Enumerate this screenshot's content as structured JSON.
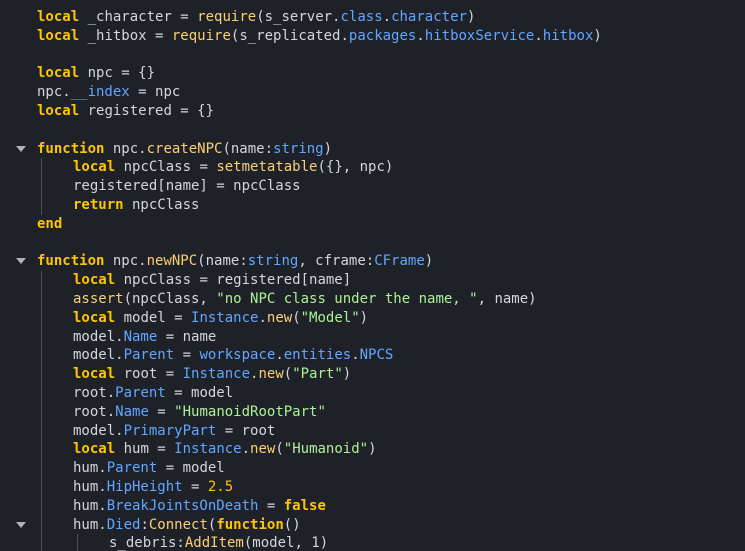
{
  "editor": {
    "language": "lua",
    "theme_colors": {
      "background": "#1e2228",
      "keyword": "#ffc600",
      "function": "#fad075",
      "property": "#61a6ff",
      "string": "#adf195",
      "plain": "#d3d6dc"
    },
    "lines": [
      {
        "fold": false,
        "indent": 0,
        "tokens": [
          {
            "t": "local",
            "c": "kw"
          },
          {
            "t": " _character = ",
            "c": "pl"
          },
          {
            "t": "require",
            "c": "fn"
          },
          {
            "t": "(s_server.",
            "c": "pl"
          },
          {
            "t": "class",
            "c": "pr"
          },
          {
            "t": ".",
            "c": "pl"
          },
          {
            "t": "character",
            "c": "pr"
          },
          {
            "t": ")",
            "c": "pl"
          }
        ]
      },
      {
        "fold": false,
        "indent": 0,
        "tokens": [
          {
            "t": "local",
            "c": "kw"
          },
          {
            "t": " _hitbox = ",
            "c": "pl"
          },
          {
            "t": "require",
            "c": "fn"
          },
          {
            "t": "(s_replicated.",
            "c": "pl"
          },
          {
            "t": "packages",
            "c": "pr"
          },
          {
            "t": ".",
            "c": "pl"
          },
          {
            "t": "hitboxService",
            "c": "pr"
          },
          {
            "t": ".",
            "c": "pl"
          },
          {
            "t": "hitbox",
            "c": "pr"
          },
          {
            "t": ")",
            "c": "pl"
          }
        ]
      },
      {
        "fold": false,
        "indent": 0,
        "tokens": []
      },
      {
        "fold": false,
        "indent": 0,
        "tokens": [
          {
            "t": "local",
            "c": "kw"
          },
          {
            "t": " npc = {}",
            "c": "pl"
          }
        ]
      },
      {
        "fold": false,
        "indent": 0,
        "tokens": [
          {
            "t": "npc.",
            "c": "pl"
          },
          {
            "t": "__index",
            "c": "pr"
          },
          {
            "t": " = npc",
            "c": "pl"
          }
        ]
      },
      {
        "fold": false,
        "indent": 0,
        "tokens": [
          {
            "t": "local",
            "c": "kw"
          },
          {
            "t": " registered = {}",
            "c": "pl"
          }
        ]
      },
      {
        "fold": false,
        "indent": 0,
        "tokens": []
      },
      {
        "fold": true,
        "indent": 0,
        "tokens": [
          {
            "t": "function",
            "c": "kw"
          },
          {
            "t": " npc.",
            "c": "pl"
          },
          {
            "t": "createNPC",
            "c": "fn"
          },
          {
            "t": "(name:",
            "c": "pl"
          },
          {
            "t": "string",
            "c": "ty"
          },
          {
            "t": ")",
            "c": "pl"
          }
        ]
      },
      {
        "fold": false,
        "indent": 1,
        "tokens": [
          {
            "t": "local",
            "c": "kw"
          },
          {
            "t": " npcClass = ",
            "c": "pl"
          },
          {
            "t": "setmetatable",
            "c": "fn"
          },
          {
            "t": "({}, npc)",
            "c": "pl"
          }
        ]
      },
      {
        "fold": false,
        "indent": 1,
        "tokens": [
          {
            "t": "registered[name] = npcClass",
            "c": "pl"
          }
        ]
      },
      {
        "fold": false,
        "indent": 1,
        "tokens": [
          {
            "t": "return",
            "c": "kw"
          },
          {
            "t": " npcClass",
            "c": "pl"
          }
        ]
      },
      {
        "fold": false,
        "indent": 0,
        "tokens": [
          {
            "t": "end",
            "c": "kw"
          }
        ]
      },
      {
        "fold": false,
        "indent": 0,
        "tokens": []
      },
      {
        "fold": true,
        "indent": 0,
        "tokens": [
          {
            "t": "function",
            "c": "kw"
          },
          {
            "t": " npc.",
            "c": "pl"
          },
          {
            "t": "newNPC",
            "c": "fn"
          },
          {
            "t": "(name:",
            "c": "pl"
          },
          {
            "t": "string",
            "c": "ty"
          },
          {
            "t": ", cframe:",
            "c": "pl"
          },
          {
            "t": "CFrame",
            "c": "ty"
          },
          {
            "t": ")",
            "c": "pl"
          }
        ]
      },
      {
        "fold": false,
        "indent": 1,
        "tokens": [
          {
            "t": "local",
            "c": "kw"
          },
          {
            "t": " npcClass = registered[name]",
            "c": "pl"
          }
        ]
      },
      {
        "fold": false,
        "indent": 1,
        "tokens": [
          {
            "t": "assert",
            "c": "fn"
          },
          {
            "t": "(npcClass, ",
            "c": "pl"
          },
          {
            "t": "\"no NPC class under the name, \"",
            "c": "st"
          },
          {
            "t": ", name)",
            "c": "pl"
          }
        ]
      },
      {
        "fold": false,
        "indent": 1,
        "tokens": [
          {
            "t": "local",
            "c": "kw"
          },
          {
            "t": " model = ",
            "c": "pl"
          },
          {
            "t": "Instance",
            "c": "pr"
          },
          {
            "t": ".",
            "c": "pl"
          },
          {
            "t": "new",
            "c": "fn"
          },
          {
            "t": "(",
            "c": "pl"
          },
          {
            "t": "\"Model\"",
            "c": "st"
          },
          {
            "t": ")",
            "c": "pl"
          }
        ]
      },
      {
        "fold": false,
        "indent": 1,
        "tokens": [
          {
            "t": "model.",
            "c": "pl"
          },
          {
            "t": "Name",
            "c": "pr"
          },
          {
            "t": " = name",
            "c": "pl"
          }
        ]
      },
      {
        "fold": false,
        "indent": 1,
        "tokens": [
          {
            "t": "model.",
            "c": "pl"
          },
          {
            "t": "Parent",
            "c": "pr"
          },
          {
            "t": " = ",
            "c": "pl"
          },
          {
            "t": "workspace",
            "c": "pr"
          },
          {
            "t": ".",
            "c": "pl"
          },
          {
            "t": "entities",
            "c": "pr"
          },
          {
            "t": ".",
            "c": "pl"
          },
          {
            "t": "NPCS",
            "c": "pr"
          }
        ]
      },
      {
        "fold": false,
        "indent": 1,
        "tokens": [
          {
            "t": "local",
            "c": "kw"
          },
          {
            "t": " root = ",
            "c": "pl"
          },
          {
            "t": "Instance",
            "c": "pr"
          },
          {
            "t": ".",
            "c": "pl"
          },
          {
            "t": "new",
            "c": "fn"
          },
          {
            "t": "(",
            "c": "pl"
          },
          {
            "t": "\"Part\"",
            "c": "st"
          },
          {
            "t": ")",
            "c": "pl"
          }
        ]
      },
      {
        "fold": false,
        "indent": 1,
        "tokens": [
          {
            "t": "root.",
            "c": "pl"
          },
          {
            "t": "Parent",
            "c": "pr"
          },
          {
            "t": " = model",
            "c": "pl"
          }
        ]
      },
      {
        "fold": false,
        "indent": 1,
        "tokens": [
          {
            "t": "root.",
            "c": "pl"
          },
          {
            "t": "Name",
            "c": "pr"
          },
          {
            "t": " = ",
            "c": "pl"
          },
          {
            "t": "\"HumanoidRootPart\"",
            "c": "st"
          }
        ]
      },
      {
        "fold": false,
        "indent": 1,
        "tokens": [
          {
            "t": "model.",
            "c": "pl"
          },
          {
            "t": "PrimaryPart",
            "c": "pr"
          },
          {
            "t": " = root",
            "c": "pl"
          }
        ]
      },
      {
        "fold": false,
        "indent": 1,
        "tokens": [
          {
            "t": "local",
            "c": "kw"
          },
          {
            "t": " hum = ",
            "c": "pl"
          },
          {
            "t": "Instance",
            "c": "pr"
          },
          {
            "t": ".",
            "c": "pl"
          },
          {
            "t": "new",
            "c": "fn"
          },
          {
            "t": "(",
            "c": "pl"
          },
          {
            "t": "\"Humanoid\"",
            "c": "st"
          },
          {
            "t": ")",
            "c": "pl"
          }
        ]
      },
      {
        "fold": false,
        "indent": 1,
        "tokens": [
          {
            "t": "hum.",
            "c": "pl"
          },
          {
            "t": "Parent",
            "c": "pr"
          },
          {
            "t": " = model",
            "c": "pl"
          }
        ]
      },
      {
        "fold": false,
        "indent": 1,
        "tokens": [
          {
            "t": "hum.",
            "c": "pl"
          },
          {
            "t": "HipHeight",
            "c": "pr"
          },
          {
            "t": " = ",
            "c": "pl"
          },
          {
            "t": "2.5",
            "c": "nm"
          }
        ]
      },
      {
        "fold": false,
        "indent": 1,
        "tokens": [
          {
            "t": "hum.",
            "c": "pl"
          },
          {
            "t": "BreakJointsOnDeath",
            "c": "pr"
          },
          {
            "t": " = ",
            "c": "pl"
          },
          {
            "t": "false",
            "c": "kw"
          }
        ]
      },
      {
        "fold": true,
        "indent": 1,
        "tokens": [
          {
            "t": "hum.",
            "c": "pl"
          },
          {
            "t": "Died",
            "c": "pr"
          },
          {
            "t": ":",
            "c": "pl"
          },
          {
            "t": "Connect",
            "c": "fn"
          },
          {
            "t": "(",
            "c": "pl"
          },
          {
            "t": "function",
            "c": "kw"
          },
          {
            "t": "()",
            "c": "pl"
          }
        ]
      },
      {
        "fold": false,
        "indent": 2,
        "tokens": [
          {
            "t": "s_debris:",
            "c": "pl"
          },
          {
            "t": "AddItem",
            "c": "fn"
          },
          {
            "t": "(model, 1)",
            "c": "pl"
          }
        ]
      }
    ]
  }
}
